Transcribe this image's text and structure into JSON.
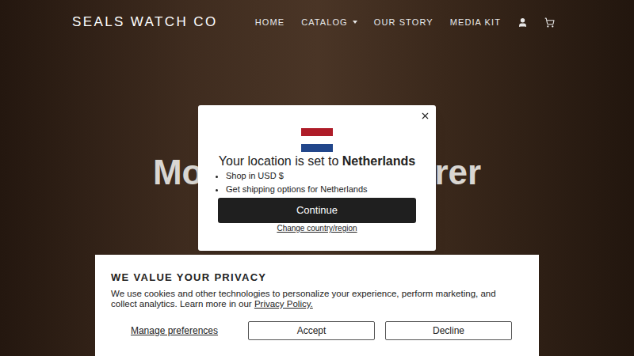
{
  "header": {
    "logo": "SEALS WATCH CO",
    "nav": [
      {
        "label": "HOME",
        "dropdown": false
      },
      {
        "label": "CATALOG",
        "dropdown": true
      },
      {
        "label": "OUR STORY",
        "dropdown": false
      },
      {
        "label": "MEDIA KIT",
        "dropdown": false
      }
    ]
  },
  "hero": {
    "title_start": "Mo",
    "title_end": "rer"
  },
  "location_modal": {
    "title_prefix": "Your location is set to ",
    "country": "Netherlands",
    "bullets": [
      "Shop in USD $",
      "Get shipping options for Netherlands"
    ],
    "continue": "Continue",
    "change": "Change country/region"
  },
  "cookie_banner": {
    "title": "WE VALUE YOUR PRIVACY",
    "text": "We use cookies and other technologies to personalize your experience, perform marketing, and collect analytics. Learn more in our ",
    "policy_link": "Privacy Policy.",
    "manage": "Manage preferences",
    "buttons": [
      "Accept",
      "Decline"
    ]
  }
}
